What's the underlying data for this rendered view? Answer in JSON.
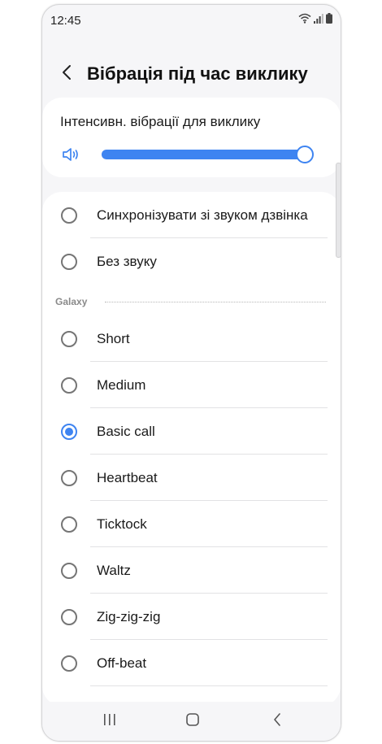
{
  "status_bar": {
    "time": "12:45",
    "icons": [
      "wifi-icon",
      "signal-icon",
      "battery-icon"
    ]
  },
  "header": {
    "back_icon": "chevron-left-icon",
    "title": "Вібрація під час виклику"
  },
  "intensity": {
    "label": "Інтенсивн. вібрації для виклику",
    "icon": "vibrate-speaker-icon",
    "level_fraction": 1.0
  },
  "options_top": [
    {
      "label": "Синхронізувати зі звуком дзвінка",
      "selected": false
    },
    {
      "label": "Без звуку",
      "selected": false
    }
  ],
  "galaxy_section": {
    "label": "Galaxy",
    "options": [
      {
        "label": "Short",
        "selected": false
      },
      {
        "label": "Medium",
        "selected": false
      },
      {
        "label": "Basic call",
        "selected": true
      },
      {
        "label": "Heartbeat",
        "selected": false
      },
      {
        "label": "Ticktock",
        "selected": false
      },
      {
        "label": "Waltz",
        "selected": false
      },
      {
        "label": "Zig-zig-zig",
        "selected": false
      },
      {
        "label": "Off-beat",
        "selected": false
      }
    ]
  },
  "nav_bar": {
    "items": [
      "recent-apps-icon",
      "home-icon",
      "back-icon"
    ]
  },
  "colors": {
    "accent": "#3e84f1",
    "background": "#f6f6f8",
    "card": "#ffffff"
  }
}
